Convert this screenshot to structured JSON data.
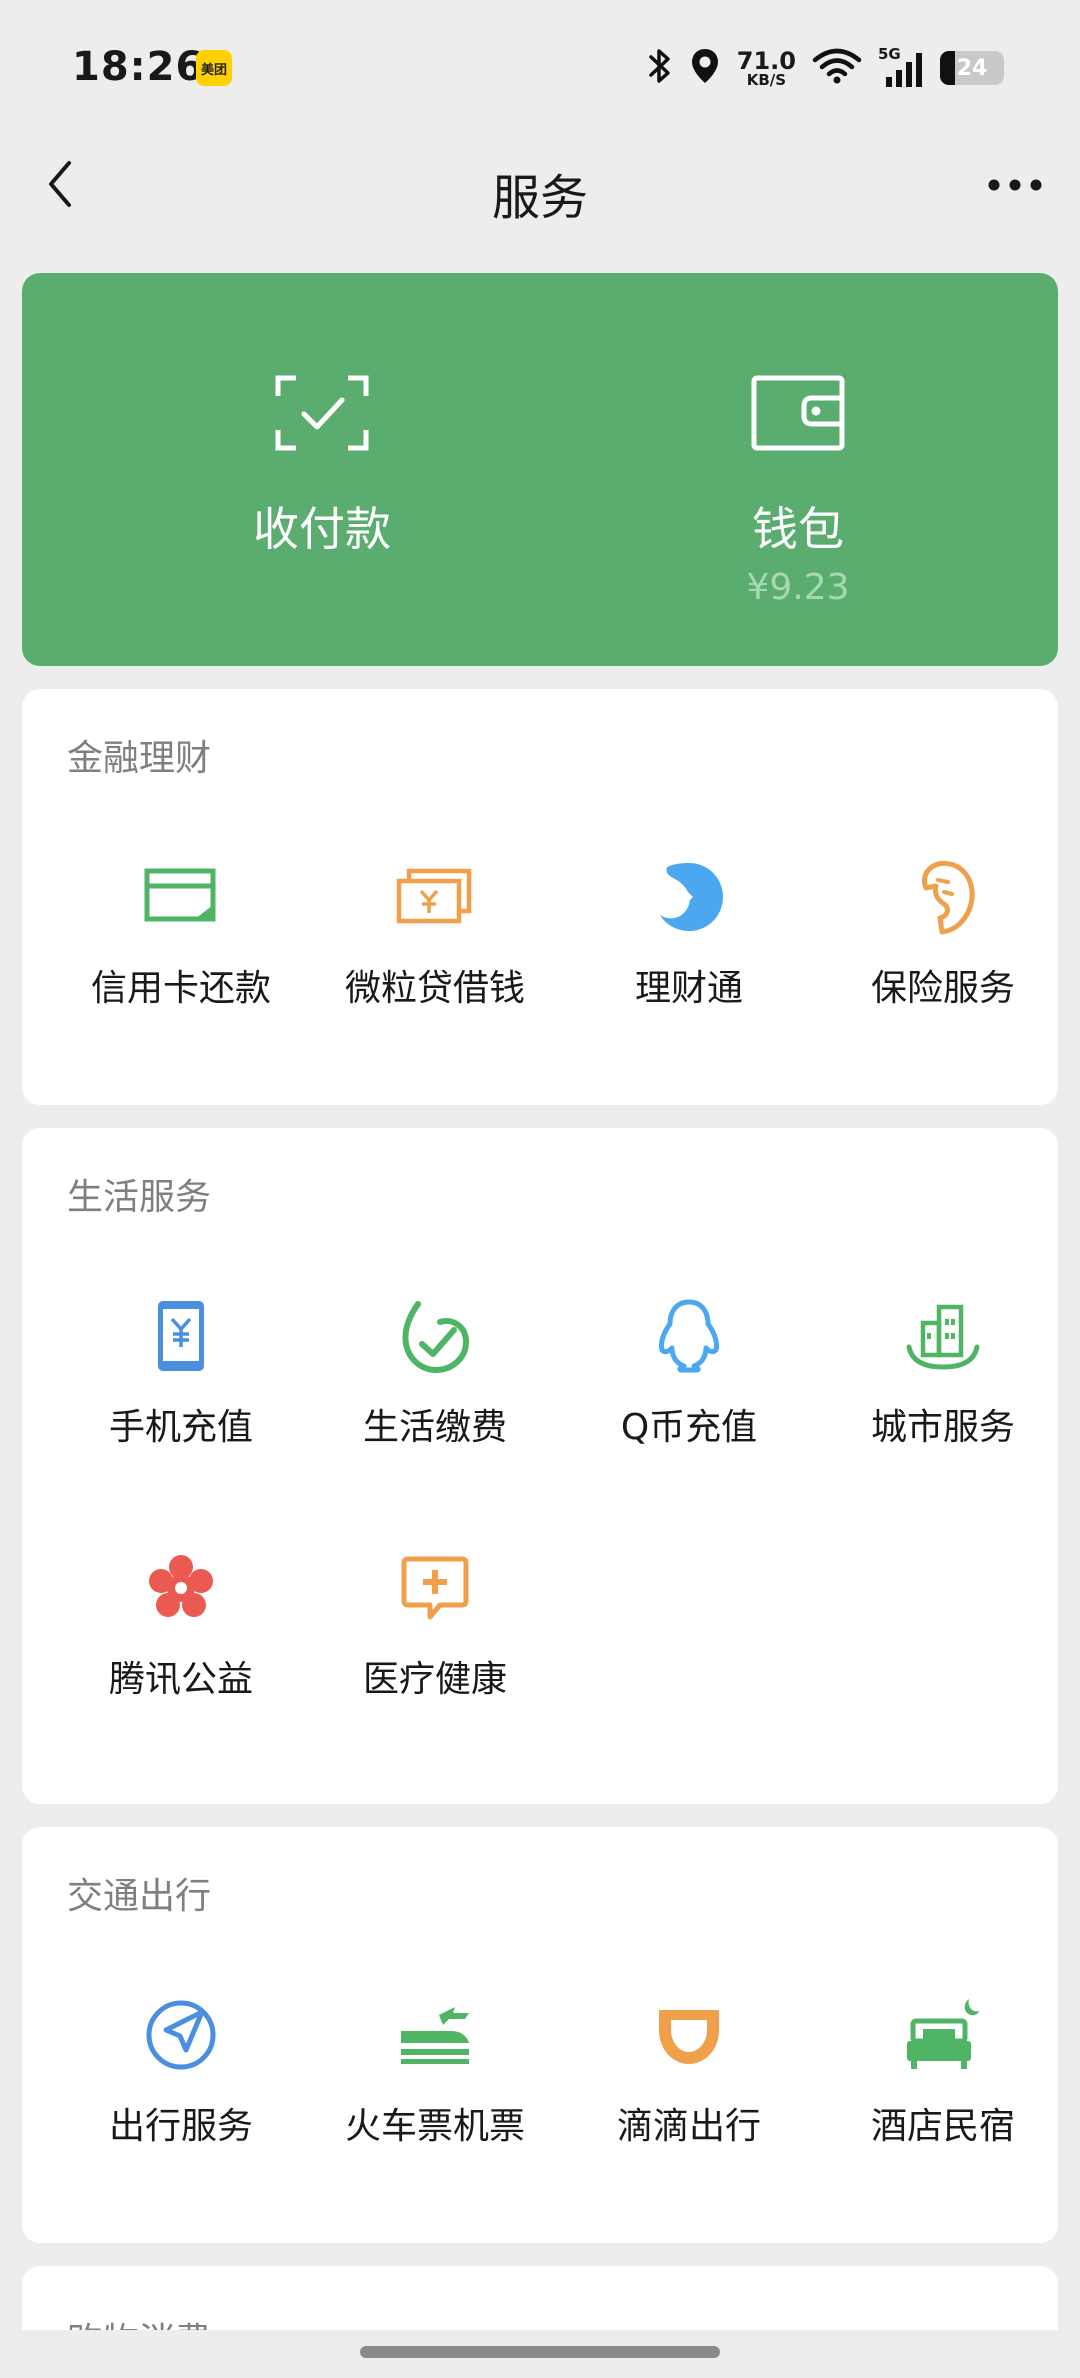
{
  "status_bar": {
    "time": "18:26",
    "app_badge": "美团",
    "net_speed_value": "71.0",
    "net_speed_unit": "KB/S",
    "network_type": "5G",
    "battery_level": "24"
  },
  "nav": {
    "title": "服务",
    "back_icon": "chevron-left-icon",
    "more_icon": "more-icon"
  },
  "banner": {
    "pay": {
      "label": "收付款",
      "icon": "scan-check-icon"
    },
    "wallet": {
      "label": "钱包",
      "balance": "¥9.23",
      "icon": "wallet-icon"
    }
  },
  "sections": {
    "finance": {
      "title": "金融理财",
      "items": [
        {
          "label": "信用卡还款",
          "icon": "credit-card-icon"
        },
        {
          "label": "微粒贷借钱",
          "icon": "cash-loan-icon"
        },
        {
          "label": "理财通",
          "icon": "wealth-icon"
        },
        {
          "label": "保险服务",
          "icon": "insurance-icon"
        }
      ]
    },
    "life": {
      "title": "生活服务",
      "items": [
        {
          "label": "手机充值",
          "icon": "phone-recharge-icon"
        },
        {
          "label": "生活缴费",
          "icon": "utility-bill-icon"
        },
        {
          "label": "Q币充值",
          "icon": "qq-coin-icon"
        },
        {
          "label": "城市服务",
          "icon": "city-service-icon"
        },
        {
          "label": "腾讯公益",
          "icon": "charity-flower-icon"
        },
        {
          "label": "医疗健康",
          "icon": "medical-icon"
        }
      ]
    },
    "transport": {
      "title": "交通出行",
      "items": [
        {
          "label": "出行服务",
          "icon": "navigation-icon"
        },
        {
          "label": "火车票机票",
          "icon": "train-plane-icon"
        },
        {
          "label": "滴滴出行",
          "icon": "didi-icon"
        },
        {
          "label": "酒店民宿",
          "icon": "hotel-bed-icon"
        }
      ]
    },
    "shopping": {
      "title": "购物消费"
    }
  },
  "colors": {
    "banner_green": "#5aad6f",
    "wechat_green": "#4fb565",
    "orange": "#f0a04b",
    "blue": "#4b8fe0",
    "light_blue": "#4aa7f0",
    "red": "#ea5a51",
    "page_bg": "#ededed"
  }
}
